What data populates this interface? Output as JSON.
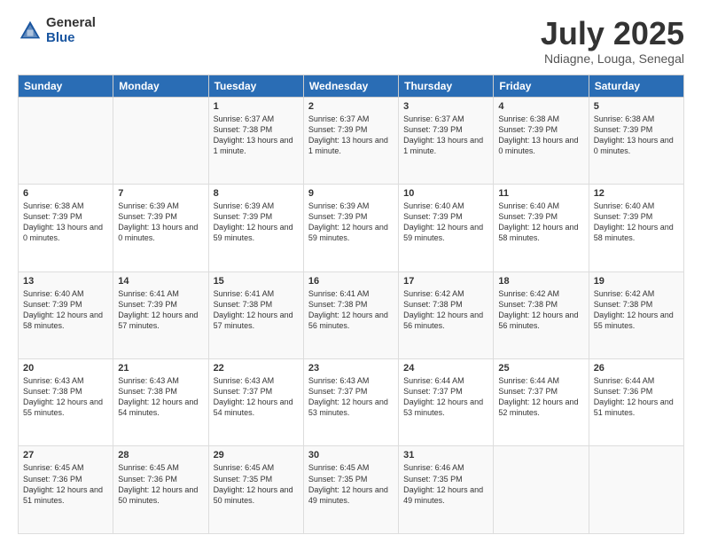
{
  "logo": {
    "general": "General",
    "blue": "Blue"
  },
  "header": {
    "title": "July 2025",
    "subtitle": "Ndiagne, Louga, Senegal"
  },
  "weekdays": [
    "Sunday",
    "Monday",
    "Tuesday",
    "Wednesday",
    "Thursday",
    "Friday",
    "Saturday"
  ],
  "weeks": [
    [
      {
        "day": "",
        "info": ""
      },
      {
        "day": "",
        "info": ""
      },
      {
        "day": "1",
        "info": "Sunrise: 6:37 AM\nSunset: 7:38 PM\nDaylight: 13 hours and 1 minute."
      },
      {
        "day": "2",
        "info": "Sunrise: 6:37 AM\nSunset: 7:39 PM\nDaylight: 13 hours and 1 minute."
      },
      {
        "day": "3",
        "info": "Sunrise: 6:37 AM\nSunset: 7:39 PM\nDaylight: 13 hours and 1 minute."
      },
      {
        "day": "4",
        "info": "Sunrise: 6:38 AM\nSunset: 7:39 PM\nDaylight: 13 hours and 0 minutes."
      },
      {
        "day": "5",
        "info": "Sunrise: 6:38 AM\nSunset: 7:39 PM\nDaylight: 13 hours and 0 minutes."
      }
    ],
    [
      {
        "day": "6",
        "info": "Sunrise: 6:38 AM\nSunset: 7:39 PM\nDaylight: 13 hours and 0 minutes."
      },
      {
        "day": "7",
        "info": "Sunrise: 6:39 AM\nSunset: 7:39 PM\nDaylight: 13 hours and 0 minutes."
      },
      {
        "day": "8",
        "info": "Sunrise: 6:39 AM\nSunset: 7:39 PM\nDaylight: 12 hours and 59 minutes."
      },
      {
        "day": "9",
        "info": "Sunrise: 6:39 AM\nSunset: 7:39 PM\nDaylight: 12 hours and 59 minutes."
      },
      {
        "day": "10",
        "info": "Sunrise: 6:40 AM\nSunset: 7:39 PM\nDaylight: 12 hours and 59 minutes."
      },
      {
        "day": "11",
        "info": "Sunrise: 6:40 AM\nSunset: 7:39 PM\nDaylight: 12 hours and 58 minutes."
      },
      {
        "day": "12",
        "info": "Sunrise: 6:40 AM\nSunset: 7:39 PM\nDaylight: 12 hours and 58 minutes."
      }
    ],
    [
      {
        "day": "13",
        "info": "Sunrise: 6:40 AM\nSunset: 7:39 PM\nDaylight: 12 hours and 58 minutes."
      },
      {
        "day": "14",
        "info": "Sunrise: 6:41 AM\nSunset: 7:39 PM\nDaylight: 12 hours and 57 minutes."
      },
      {
        "day": "15",
        "info": "Sunrise: 6:41 AM\nSunset: 7:38 PM\nDaylight: 12 hours and 57 minutes."
      },
      {
        "day": "16",
        "info": "Sunrise: 6:41 AM\nSunset: 7:38 PM\nDaylight: 12 hours and 56 minutes."
      },
      {
        "day": "17",
        "info": "Sunrise: 6:42 AM\nSunset: 7:38 PM\nDaylight: 12 hours and 56 minutes."
      },
      {
        "day": "18",
        "info": "Sunrise: 6:42 AM\nSunset: 7:38 PM\nDaylight: 12 hours and 56 minutes."
      },
      {
        "day": "19",
        "info": "Sunrise: 6:42 AM\nSunset: 7:38 PM\nDaylight: 12 hours and 55 minutes."
      }
    ],
    [
      {
        "day": "20",
        "info": "Sunrise: 6:43 AM\nSunset: 7:38 PM\nDaylight: 12 hours and 55 minutes."
      },
      {
        "day": "21",
        "info": "Sunrise: 6:43 AM\nSunset: 7:38 PM\nDaylight: 12 hours and 54 minutes."
      },
      {
        "day": "22",
        "info": "Sunrise: 6:43 AM\nSunset: 7:37 PM\nDaylight: 12 hours and 54 minutes."
      },
      {
        "day": "23",
        "info": "Sunrise: 6:43 AM\nSunset: 7:37 PM\nDaylight: 12 hours and 53 minutes."
      },
      {
        "day": "24",
        "info": "Sunrise: 6:44 AM\nSunset: 7:37 PM\nDaylight: 12 hours and 53 minutes."
      },
      {
        "day": "25",
        "info": "Sunrise: 6:44 AM\nSunset: 7:37 PM\nDaylight: 12 hours and 52 minutes."
      },
      {
        "day": "26",
        "info": "Sunrise: 6:44 AM\nSunset: 7:36 PM\nDaylight: 12 hours and 51 minutes."
      }
    ],
    [
      {
        "day": "27",
        "info": "Sunrise: 6:45 AM\nSunset: 7:36 PM\nDaylight: 12 hours and 51 minutes."
      },
      {
        "day": "28",
        "info": "Sunrise: 6:45 AM\nSunset: 7:36 PM\nDaylight: 12 hours and 50 minutes."
      },
      {
        "day": "29",
        "info": "Sunrise: 6:45 AM\nSunset: 7:35 PM\nDaylight: 12 hours and 50 minutes."
      },
      {
        "day": "30",
        "info": "Sunrise: 6:45 AM\nSunset: 7:35 PM\nDaylight: 12 hours and 49 minutes."
      },
      {
        "day": "31",
        "info": "Sunrise: 6:46 AM\nSunset: 7:35 PM\nDaylight: 12 hours and 49 minutes."
      },
      {
        "day": "",
        "info": ""
      },
      {
        "day": "",
        "info": ""
      }
    ]
  ]
}
